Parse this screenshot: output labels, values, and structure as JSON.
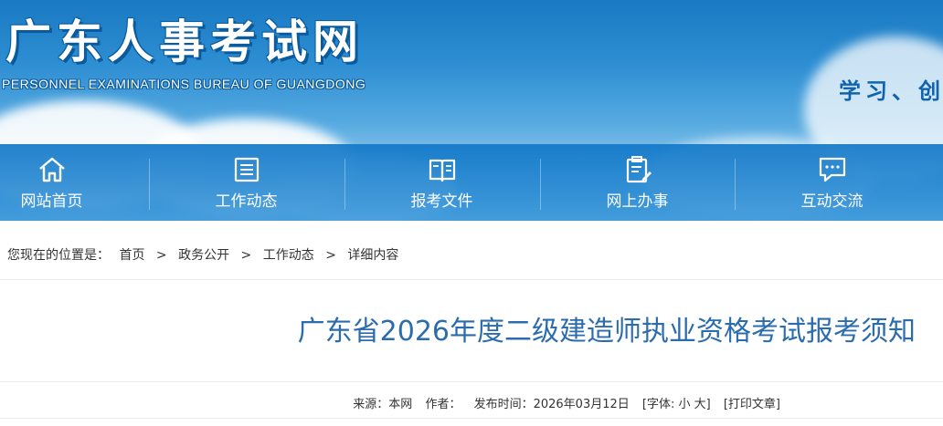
{
  "site": {
    "title": "广东人事考试网",
    "subtitle": "PERSONNEL EXAMINATIONS BUREAU OF GUANGDONG",
    "slogan": "学习、创新"
  },
  "nav": [
    {
      "label": "网站首页",
      "icon": "home-icon"
    },
    {
      "label": "工作动态",
      "icon": "document-icon"
    },
    {
      "label": "报考文件",
      "icon": "book-icon"
    },
    {
      "label": "网上办事",
      "icon": "clipboard-edit-icon"
    },
    {
      "label": "互动交流",
      "icon": "chat-icon"
    }
  ],
  "breadcrumb": {
    "prefix": "您现在的位置是：",
    "items": [
      "首页",
      "政务公开",
      "工作动态",
      "详细内容"
    ],
    "separator": ">"
  },
  "article": {
    "title": "广东省2026年度二级建造师执业资格考试报考须知",
    "source": "来源：本网",
    "author": "作者：",
    "date": "发布时间：2026年03月12日",
    "font_size_control": "[字体: 小 大]",
    "print": "[打印文章]"
  },
  "colors": {
    "banner_top": "#1979c2",
    "title_blue": "#2b6cae"
  }
}
